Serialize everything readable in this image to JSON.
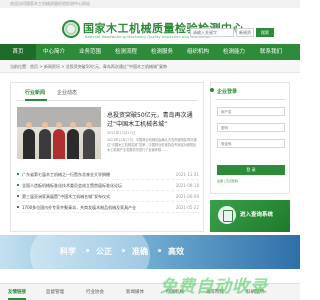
{
  "topbar": {
    "text": "欢迎访问国家木工机械质量检验检测中心网站"
  },
  "header": {
    "title": "国家木工机械质量检验检测中心",
    "subtitle": "National Woodworking Machinery Quality Inspection and Test Center",
    "search_placeholder": "请输入关键字",
    "search_scope": "新闻资",
    "search_button": "搜索"
  },
  "nav": {
    "items": [
      {
        "label": "首页"
      },
      {
        "label": "中心简介"
      },
      {
        "label": "业务范围"
      },
      {
        "label": "检测流程"
      },
      {
        "label": "检测服务"
      },
      {
        "label": "组织机构"
      },
      {
        "label": "检测能力"
      },
      {
        "label": "联系我们"
      }
    ]
  },
  "breadcrumb": {
    "text": "当前位置：首页 > 新闻资讯 > 总投资突破50亿元，青岛再次通过“中国木工机械城”复审"
  },
  "main": {
    "tabs": [
      {
        "label": "行业新闻"
      },
      {
        "label": "企业动态"
      }
    ],
    "headline": "总投资突破50亿元，青岛再次通过“中国木工机械名城”",
    "headline_date": "2021年12月27日",
    "headline_summary": "2021年12月27日，中国林业机械协会确认青岛市城阳区再次通过“中国木工机械名城”复审，中国林业机械协会专家组对城阳区木工机械产业发展情况进行了全面考核……",
    "news": [
      {
        "title": "广东省第七届木工机械之一行暨东北林业大学捐赠",
        "date": "2021-11-21"
      },
      {
        "title": "全国人造板机械标准化技术委员会成立暨首届标准化论坛",
        "date": "2021-09-18"
      },
      {
        "title": "第三届亚洲家具展暨“中国木工机械名城”发布仪式",
        "date": "2021-06-09"
      },
      {
        "title": "1700多位国内外专家齐聚青岛，共商发展木制品机械及家具产业",
        "date": "2021-05-22"
      }
    ]
  },
  "login": {
    "header": "企业登录",
    "username_placeholder": "用户名",
    "password_placeholder": "密码",
    "code_placeholder": "验证码",
    "button": "登 录",
    "links": "注册  |  忘记密码"
  },
  "service_banner": {
    "label": "进入查询系统"
  },
  "slogan": {
    "words": [
      "科学",
      "公正",
      "准确",
      "高效"
    ]
  },
  "footer": {
    "tabs": [
      {
        "label": "友情链接"
      },
      {
        "label": "监督管理"
      },
      {
        "label": "行业协会"
      },
      {
        "label": "新闻媒体"
      },
      {
        "label": "检测机构"
      },
      {
        "label": "高等院校"
      },
      {
        "label": "科研院所"
      }
    ]
  },
  "watermark": {
    "text": "免费自动收录"
  },
  "colors": {
    "brand_green": "#2e8b3a",
    "nav_active": "#1f6b29",
    "banner_blue": "#2e6fa8"
  }
}
